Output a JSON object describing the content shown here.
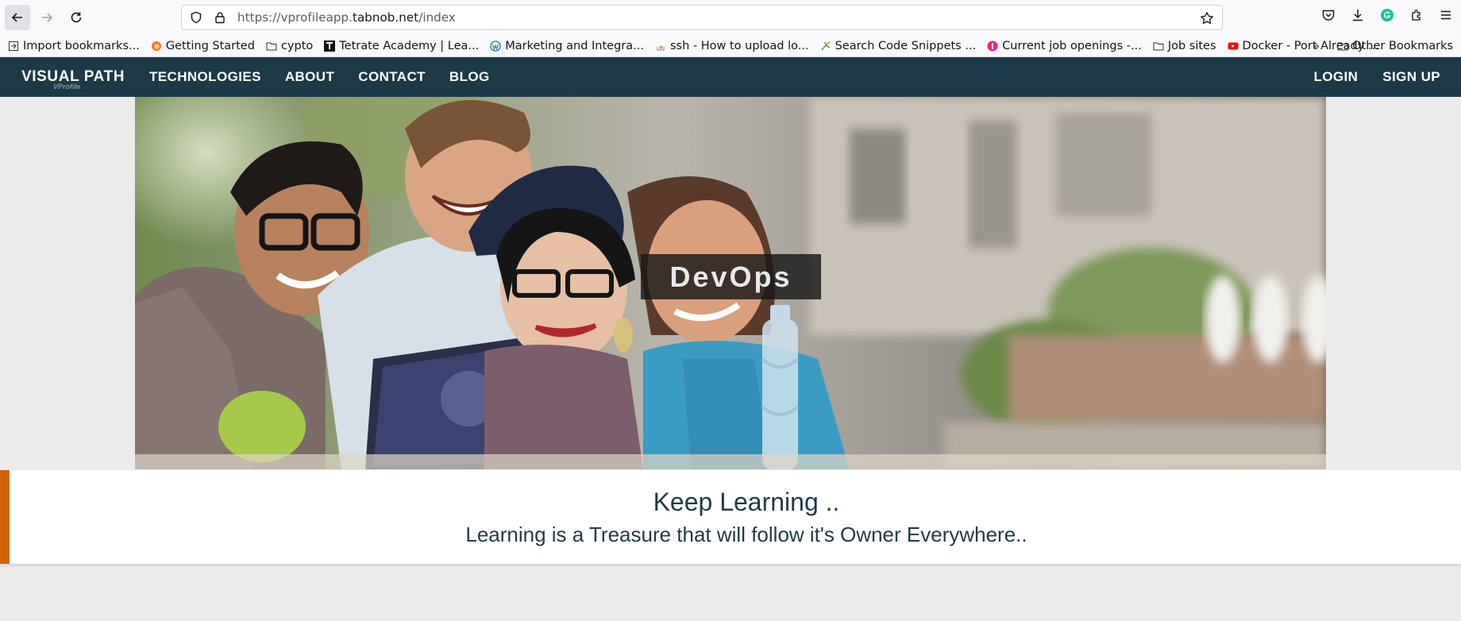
{
  "browser": {
    "url_prefix": "https://vprofileapp.",
    "url_host": "tabnob.net",
    "url_path": "/index",
    "bookmarks": [
      {
        "label": "Import bookmarks...",
        "icon": "import-icon"
      },
      {
        "label": "Getting Started",
        "icon": "firefox-icon"
      },
      {
        "label": "cypto",
        "icon": "folder-icon"
      },
      {
        "label": "Tetrate Academy | Lea...",
        "icon": "tetrate-icon"
      },
      {
        "label": "Marketing and Integra...",
        "icon": "wordpress-icon"
      },
      {
        "label": "ssh - How to upload lo...",
        "icon": "stackoverflow-icon"
      },
      {
        "label": "Search Code Snippets ...",
        "icon": "snippet-icon"
      },
      {
        "label": "Current job openings -...",
        "icon": "jobs-icon"
      },
      {
        "label": "Job sites",
        "icon": "folder-icon"
      },
      {
        "label": "Docker - Port Already ...",
        "icon": "youtube-icon"
      }
    ],
    "other_bookmarks": "Other Bookmarks"
  },
  "site": {
    "brand": "VISUAL PATH",
    "brand_sub": "VProfile",
    "menu": [
      "TECHNOLOGIES",
      "ABOUT",
      "CONTACT",
      "BLOG"
    ],
    "login": "LOGIN",
    "signup": "SIGN UP"
  },
  "hero": {
    "caption": "DevOps"
  },
  "quote": {
    "title": "Keep Learning ..",
    "subtitle": "Learning is a Treasure that will follow it's Owner Everywhere.."
  },
  "colors": {
    "nav_bg": "#1c3a47",
    "accent_bar": "#d0630c",
    "text_dark": "#1f3a47"
  }
}
